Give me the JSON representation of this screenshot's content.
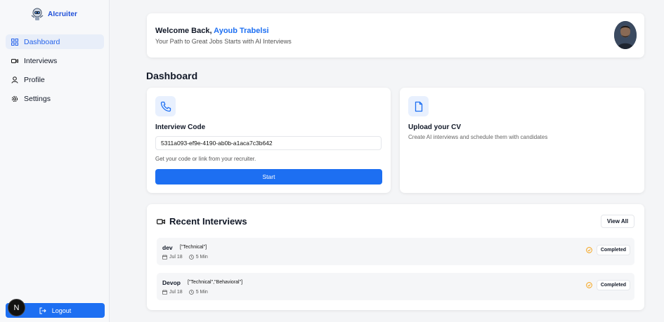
{
  "brand": {
    "name": "AIcruiter",
    "logo_icon": "robot-logo-icon"
  },
  "sidebar": {
    "items": [
      {
        "label": "Dashboard",
        "icon": "grid-icon",
        "active": true
      },
      {
        "label": "Interviews",
        "icon": "video-icon",
        "active": false
      },
      {
        "label": "Profile",
        "icon": "user-icon",
        "active": false
      },
      {
        "label": "Settings",
        "icon": "gear-icon",
        "active": false
      }
    ],
    "logout_label": "Logout",
    "badge": "N"
  },
  "welcome": {
    "greeting": "Welcome Back,",
    "user_name": "Ayoub Trabelsi",
    "subtitle": "Your Path to Great Jobs Starts with AI Interviews"
  },
  "dashboard": {
    "title": "Dashboard",
    "interview_code": {
      "title": "Interview Code",
      "value": "5311a093-ef9e-4190-ab0b-a1aca7c3b642",
      "hint": "Get your code or link from your recruiter.",
      "button_label": "Start"
    },
    "upload_cv": {
      "title": "Upload your CV",
      "subtitle": "Create AI interviews and schedule them with candidates"
    }
  },
  "recent": {
    "title": "Recent Interviews",
    "view_all_label": "View All",
    "rows": [
      {
        "name": "dev",
        "tags": "[\"Technical\"]",
        "date": "Jul 18",
        "duration": "5 Min",
        "status": "Completed"
      },
      {
        "name": "Devop",
        "tags": "[\"Technical\",\"Behavioral\"]",
        "date": "Jul 18",
        "duration": "5 Min",
        "status": "Completed"
      }
    ]
  },
  "colors": {
    "accent": "#1d6ff2",
    "status_icon": "#f59e0b"
  }
}
